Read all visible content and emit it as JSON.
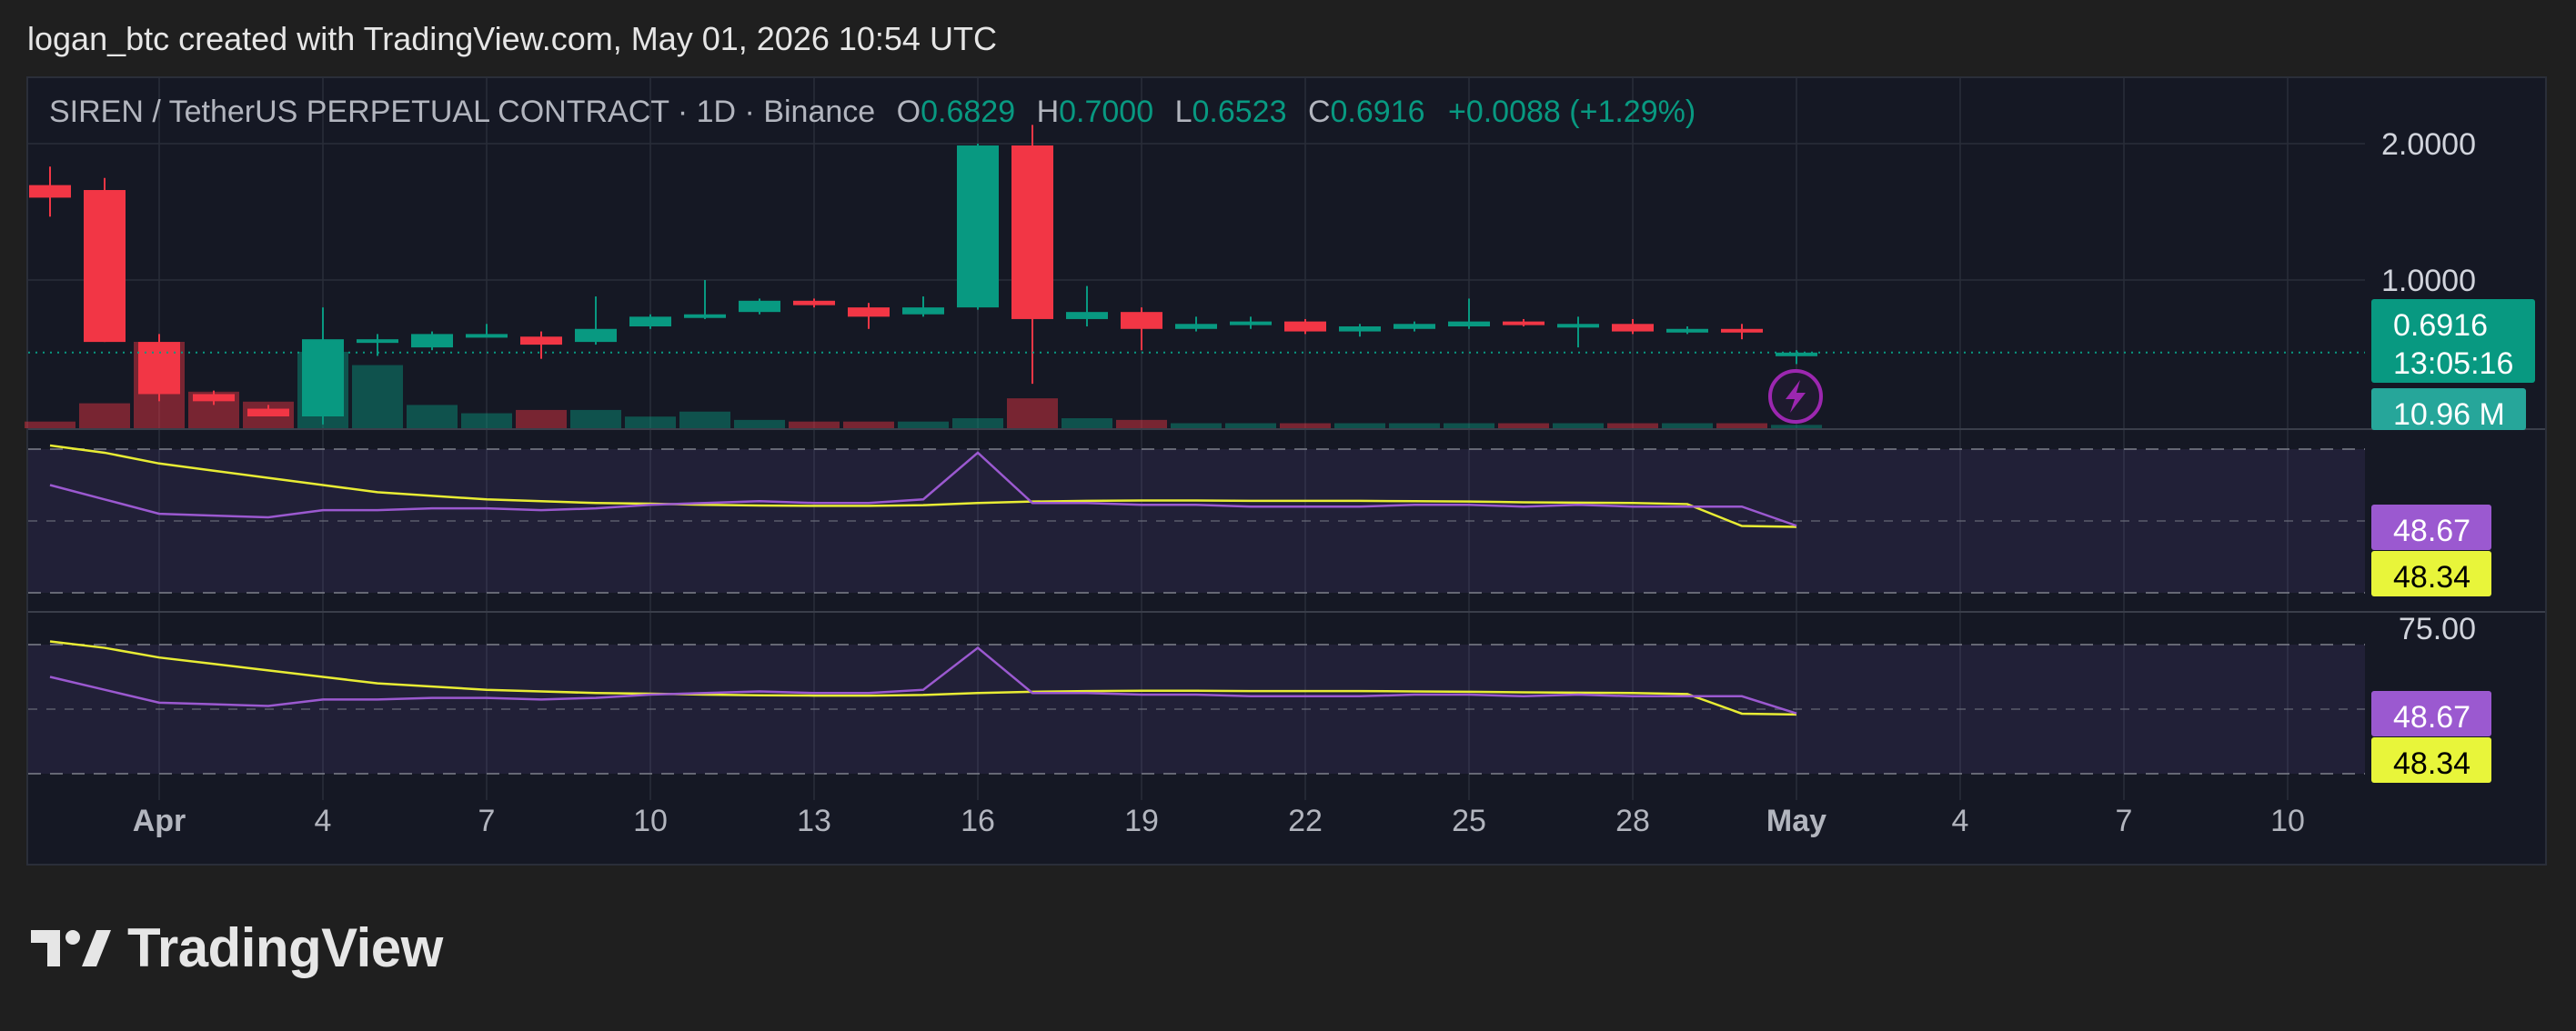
{
  "header": {
    "attribution": "logan_btc created with TradingView.com, May 01, 2026 10:54 UTC"
  },
  "legend": {
    "symbol": "SIREN / TetherUS PERPETUAL CONTRACT · 1D · Binance",
    "open_label": "O",
    "open": "0.6829",
    "high_label": "H",
    "high": "0.7000",
    "low_label": "L",
    "low": "0.6523",
    "close_label": "C",
    "close": "0.6916",
    "change": "+0.0088 (+1.29%)"
  },
  "price_tag": {
    "price": "0.6916",
    "countdown": "13:05:16"
  },
  "volume_tag": "10.96 M",
  "rsi_tags": {
    "rsi": "48.67",
    "rsi_ma": "48.34"
  },
  "rsi2_tags": {
    "rsi": "48.67",
    "rsi_ma": "48.34"
  },
  "rsi2_axis_label": "75.00",
  "footer": {
    "logo_text": "TradingView"
  },
  "colors": {
    "up": "#089981",
    "down": "#f23645",
    "rsi_line": "#9b59d0",
    "rsi_ma_line": "#e8ec34",
    "price_tag_bg": "#089981",
    "volume_tag_bg": "#26a69a",
    "rsi_tag_bg": "#9b59d0",
    "rsi_ma_tag_bg": "#e8f53a",
    "background": "#151824",
    "grid": "#2a2e39"
  },
  "icons": {
    "alert": "lightning-bolt-icon",
    "logo": "tradingview-logo-icon"
  },
  "chart_data": {
    "type": "candlestick",
    "y_scale": "log",
    "price_axis_ticks": [
      "2.0000",
      "1.0000"
    ],
    "x_tick_labels": [
      "Apr",
      "4",
      "7",
      "10",
      "13",
      "16",
      "19",
      "22",
      "25",
      "28",
      "May",
      "4",
      "7",
      "10"
    ],
    "x_tick_bold": [
      "Apr",
      "May"
    ],
    "dates": [
      "Mar 30",
      "Mar 31",
      "Apr 1",
      "Apr 2",
      "Apr 3",
      "Apr 4",
      "Apr 5",
      "Apr 6",
      "Apr 7",
      "Apr 8",
      "Apr 9",
      "Apr 10",
      "Apr 11",
      "Apr 12",
      "Apr 13",
      "Apr 14",
      "Apr 15",
      "Apr 16",
      "Apr 17",
      "Apr 18",
      "Apr 19",
      "Apr 20",
      "Apr 21",
      "Apr 22",
      "Apr 23",
      "Apr 24",
      "Apr 25",
      "Apr 26",
      "Apr 27",
      "Apr 28",
      "Apr 29",
      "Apr 30",
      "May 1"
    ],
    "ohlc": [
      [
        1.62,
        1.78,
        1.38,
        1.52
      ],
      [
        1.58,
        1.68,
        0.73,
        0.73
      ],
      [
        0.73,
        0.76,
        0.54,
        0.56
      ],
      [
        0.56,
        0.57,
        0.53,
        0.54
      ],
      [
        0.52,
        0.53,
        0.5,
        0.5
      ],
      [
        0.5,
        0.87,
        0.48,
        0.74
      ],
      [
        0.73,
        0.76,
        0.68,
        0.74
      ],
      [
        0.71,
        0.77,
        0.7,
        0.76
      ],
      [
        0.76,
        0.8,
        0.75,
        0.76
      ],
      [
        0.75,
        0.77,
        0.67,
        0.72
      ],
      [
        0.73,
        0.92,
        0.72,
        0.78
      ],
      [
        0.79,
        0.84,
        0.78,
        0.83
      ],
      [
        0.83,
        1.0,
        0.82,
        0.84
      ],
      [
        0.85,
        0.91,
        0.84,
        0.9
      ],
      [
        0.9,
        0.91,
        0.87,
        0.88
      ],
      [
        0.87,
        0.89,
        0.78,
        0.83
      ],
      [
        0.84,
        0.92,
        0.83,
        0.87
      ],
      [
        0.87,
        2.0,
        0.86,
        2.0
      ],
      [
        2.0,
        2.2,
        0.59,
        0.82
      ],
      [
        0.82,
        0.97,
        0.79,
        0.85
      ],
      [
        0.85,
        0.87,
        0.7,
        0.78
      ],
      [
        0.78,
        0.83,
        0.77,
        0.8
      ],
      [
        0.8,
        0.83,
        0.78,
        0.81
      ],
      [
        0.81,
        0.82,
        0.76,
        0.77
      ],
      [
        0.77,
        0.8,
        0.75,
        0.79
      ],
      [
        0.78,
        0.81,
        0.77,
        0.8
      ],
      [
        0.79,
        0.91,
        0.78,
        0.81
      ],
      [
        0.81,
        0.82,
        0.79,
        0.8
      ],
      [
        0.79,
        0.83,
        0.71,
        0.8
      ],
      [
        0.8,
        0.82,
        0.76,
        0.77
      ],
      [
        0.77,
        0.79,
        0.76,
        0.78
      ],
      [
        0.78,
        0.8,
        0.74,
        0.77
      ],
      [
        0.6829,
        0.7,
        0.6523,
        0.6916
      ]
    ],
    "current_price": 0.6916,
    "volume": [
      4,
      15,
      52,
      22,
      16,
      46,
      38,
      14,
      9,
      11,
      11,
      7,
      10,
      5,
      4,
      4,
      4,
      6,
      18,
      6,
      5,
      3,
      3,
      3,
      3,
      3,
      3,
      3,
      3,
      3,
      3,
      3,
      2
    ],
    "rsi_panel": {
      "levels": [
        70,
        50,
        30
      ],
      "rsi": [
        60,
        56,
        52,
        51.5,
        51,
        53,
        53,
        53.5,
        53.5,
        53,
        53.5,
        54.5,
        55,
        55.5,
        55,
        55,
        56,
        69,
        55,
        55,
        54.5,
        54.5,
        54,
        54,
        54,
        54.5,
        54.5,
        54,
        54.5,
        54,
        54,
        54,
        48.67
      ],
      "rsi_ma": [
        71,
        69,
        66,
        64,
        62,
        60,
        58,
        57,
        56,
        55.5,
        55,
        54.8,
        54.5,
        54.3,
        54.2,
        54.2,
        54.4,
        55,
        55.4,
        55.6,
        55.7,
        55.7,
        55.6,
        55.6,
        55.6,
        55.5,
        55.4,
        55.2,
        55.1,
        55,
        54.7,
        48.6,
        48.34
      ]
    }
  }
}
